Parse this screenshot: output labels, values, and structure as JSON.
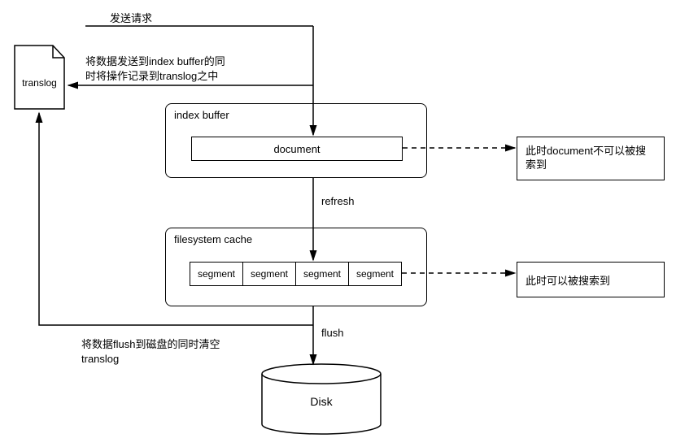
{
  "labels": {
    "send_request": "发送请求",
    "to_translog": "将数据发送到index buffer的同\n时将操作记录到translog之中",
    "translog": "translog",
    "index_buffer_title": "index buffer",
    "document": "document",
    "refresh": "refresh",
    "filesystem_cache_title": "filesystem cache",
    "segment": "segment",
    "flush": "flush",
    "flush_clear": "将数据flush到磁盘的同时清空\ntranslog",
    "disk": "Disk",
    "note1": "此时document不可以被搜\n索到",
    "note2": "此时可以被搜索到"
  }
}
